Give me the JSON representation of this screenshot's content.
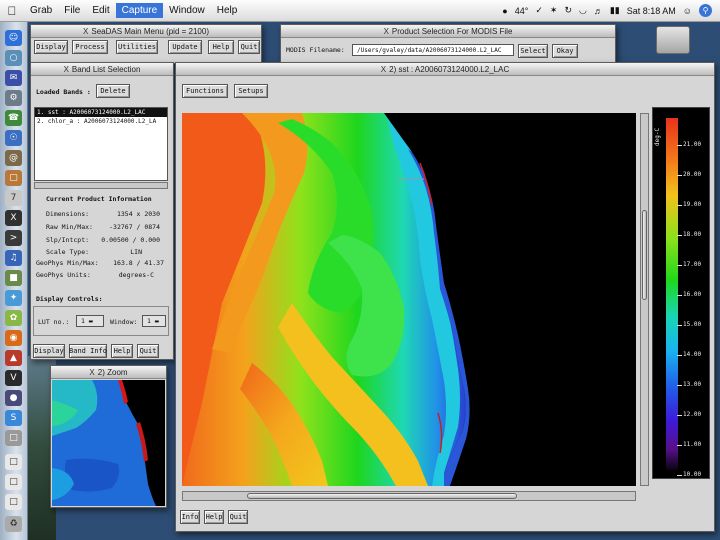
{
  "menubar": {
    "apple": "",
    "items": [
      "Grab",
      "File",
      "Edit",
      "Capture",
      "Window",
      "Help"
    ],
    "active": "Capture",
    "status": {
      "temperature": "44°",
      "clock": "Sat 8:18 AM"
    }
  },
  "seadas_main": {
    "title": "SeaDAS Main Menu (pid = 2100)",
    "buttons": [
      "Display",
      "Process",
      "Utilities",
      "Update",
      "Help",
      "Quit"
    ]
  },
  "product_selection": {
    "title": "Product Selection For MODIS File",
    "filename_label": "MODIS Filename:",
    "filename_value": "/Users/gvaley/data/A2006073124000.L2_LAC",
    "select_button": "Select",
    "okay_button": "Okay"
  },
  "band_list": {
    "title": "Band List Selection",
    "loaded_bands_label": "Loaded Bands :",
    "delete_button": "Delete",
    "bands": [
      "1. sst : A2006073124000.L2_LAC",
      "2. chlor_a : A2006073124000.L2_LA"
    ],
    "selected_index": 0,
    "info_heading": "Current Product Information",
    "info_rows": [
      {
        "label": "Dimensions:",
        "value": "1354 x 2030"
      },
      {
        "label": "Raw Min/Max:",
        "value": "-32767 / 0874"
      },
      {
        "label": "Slp/Intcpt:",
        "value": "0.00500 / 0.000"
      },
      {
        "label": "Scale Type:",
        "value": "LIN"
      },
      {
        "label": "GeoPhys Min/Max:",
        "value": "163.8 / 41.37"
      },
      {
        "label": "GeoPhys Units:",
        "value": "degrees-C"
      }
    ],
    "display_controls_label": "Display Controls:",
    "lut_label": "LUT no.:",
    "lut_value": "1",
    "window_label": "Window:",
    "window_value": "1",
    "bottom_buttons": [
      "Display",
      "Band Info",
      "Help",
      "Quit"
    ]
  },
  "image_window": {
    "title": "2) sst : A2006073124000.L2_LAC",
    "toolbar": [
      "Functions",
      "Setups"
    ],
    "bottom_buttons": [
      "Info",
      "Help",
      "Quit"
    ],
    "colorbar": {
      "title": "deg-C",
      "ticks": [
        "18.00",
        "17.00",
        "16.00",
        "15.00",
        "14.00",
        "13.00",
        "12.00",
        "11.00",
        "10.00",
        "19.00",
        "20.00",
        "21.00"
      ]
    }
  },
  "zoom_window": {
    "title": "2) Zoom"
  },
  "colors": {
    "menu_highlight": "#3875d7",
    "window_bg": "#d6d6d6",
    "image_bg": "#000000"
  }
}
